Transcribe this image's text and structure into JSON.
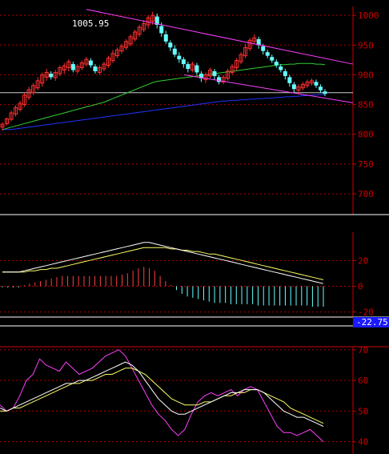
{
  "chart_data": [
    {
      "type": "candlestick",
      "panel": "price",
      "ylim": [
        665,
        1015
      ],
      "y_ticks": [
        700,
        750,
        800,
        850,
        900,
        950,
        1000
      ],
      "peak_label": "1005.95",
      "colors": {
        "up": "#ff3030",
        "down": "#66ffff",
        "ma_short": "#cccccc",
        "ma_mid": "#33cc33",
        "ma_long": "#2233ff",
        "trend": "#ff40ff",
        "axis": "#cc0000"
      },
      "candles": [
        [
          812,
          817,
          806,
          820
        ],
        [
          818,
          826,
          815,
          828
        ],
        [
          825,
          836,
          822,
          840
        ],
        [
          834,
          845,
          830,
          849
        ],
        [
          842,
          852,
          838,
          856
        ],
        [
          850,
          866,
          846,
          870
        ],
        [
          862,
          875,
          858,
          880
        ],
        [
          870,
          882,
          866,
          886
        ],
        [
          878,
          890,
          874,
          896
        ],
        [
          886,
          900,
          880,
          904
        ],
        [
          896,
          904,
          890,
          910
        ],
        [
          902,
          896,
          892,
          906
        ],
        [
          895,
          904,
          890,
          908
        ],
        [
          902,
          912,
          898,
          916
        ],
        [
          908,
          915,
          902,
          920
        ],
        [
          912,
          922,
          906,
          926
        ],
        [
          918,
          908,
          904,
          922
        ],
        [
          906,
          914,
          902,
          918
        ],
        [
          912,
          920,
          908,
          924
        ],
        [
          918,
          926,
          914,
          930
        ],
        [
          924,
          916,
          912,
          928
        ],
        [
          914,
          906,
          902,
          918
        ],
        [
          904,
          912,
          900,
          916
        ],
        [
          910,
          918,
          906,
          922
        ],
        [
          916,
          928,
          912,
          932
        ],
        [
          924,
          936,
          920,
          942
        ],
        [
          932,
          942,
          928,
          946
        ],
        [
          940,
          948,
          936,
          952
        ],
        [
          946,
          956,
          942,
          960
        ],
        [
          952,
          964,
          948,
          968
        ],
        [
          960,
          972,
          956,
          976
        ],
        [
          968,
          980,
          964,
          984
        ],
        [
          976,
          986,
          972,
          992
        ],
        [
          984,
          996,
          978,
          1000
        ],
        [
          990,
          1000,
          984,
          1006
        ],
        [
          998,
          984,
          978,
          1003
        ],
        [
          982,
          970,
          964,
          988
        ],
        [
          968,
          956,
          952,
          974
        ],
        [
          954,
          946,
          940,
          958
        ],
        [
          944,
          934,
          930,
          950
        ],
        [
          932,
          926,
          920,
          938
        ],
        [
          926,
          918,
          912,
          930
        ],
        [
          918,
          910,
          904,
          922
        ],
        [
          908,
          918,
          904,
          922
        ],
        [
          916,
          904,
          900,
          920
        ],
        [
          902,
          894,
          888,
          906
        ],
        [
          892,
          900,
          886,
          904
        ],
        [
          898,
          908,
          894,
          912
        ],
        [
          906,
          898,
          892,
          910
        ],
        [
          896,
          888,
          884,
          900
        ],
        [
          888,
          896,
          884,
          900
        ],
        [
          894,
          906,
          890,
          910
        ],
        [
          904,
          914,
          900,
          918
        ],
        [
          912,
          924,
          908,
          928
        ],
        [
          922,
          934,
          918,
          938
        ],
        [
          932,
          946,
          928,
          952
        ],
        [
          944,
          958,
          940,
          962
        ],
        [
          956,
          962,
          952,
          968
        ],
        [
          960,
          950,
          944,
          964
        ],
        [
          948,
          940,
          934,
          952
        ],
        [
          938,
          932,
          928,
          942
        ],
        [
          930,
          924,
          920,
          934
        ],
        [
          922,
          916,
          912,
          926
        ],
        [
          914,
          908,
          904,
          918
        ],
        [
          906,
          898,
          892,
          910
        ],
        [
          896,
          886,
          880,
          900
        ],
        [
          884,
          876,
          870,
          888
        ],
        [
          874,
          880,
          868,
          884
        ],
        [
          878,
          884,
          874,
          888
        ],
        [
          882,
          888,
          878,
          892
        ],
        [
          886,
          890,
          882,
          894
        ],
        [
          888,
          882,
          878,
          892
        ],
        [
          880,
          874,
          870,
          884
        ],
        [
          872,
          868,
          864,
          876
        ]
      ],
      "ma_short": [
        870,
        870,
        870,
        870,
        870,
        870,
        870,
        870,
        870,
        870,
        870,
        870,
        870,
        870,
        870,
        870,
        870,
        870,
        870,
        870,
        870,
        870,
        870,
        870,
        870,
        870,
        870,
        870,
        870,
        870,
        870,
        870,
        870,
        870,
        870,
        870,
        870,
        870,
        870,
        870,
        870,
        870,
        870,
        870,
        870,
        870,
        870,
        870,
        870,
        870,
        870,
        870,
        870,
        870,
        870,
        870,
        870,
        870,
        870,
        870,
        870,
        870,
        870,
        870,
        870,
        870,
        870,
        870,
        870,
        870,
        870,
        870,
        870,
        870
      ],
      "ma_mid": [
        808,
        810,
        812,
        814,
        816,
        818,
        820,
        822,
        824,
        826,
        828,
        830,
        832,
        834,
        836,
        838,
        840,
        842,
        844,
        846,
        848,
        850,
        852,
        854,
        857,
        860,
        863,
        866,
        869,
        872,
        875,
        878,
        881,
        884,
        887,
        889,
        890,
        891,
        892,
        893,
        894,
        895,
        896,
        897,
        898,
        899,
        900,
        901,
        902,
        903,
        904,
        905,
        906,
        907,
        908,
        909,
        910,
        911,
        912,
        913,
        914,
        915,
        916,
        917,
        917,
        918,
        918,
        919,
        919,
        919,
        919,
        918,
        918,
        917
      ],
      "ma_long": [
        808,
        808,
        808,
        809,
        810,
        811,
        812,
        813,
        814,
        815,
        816,
        817,
        818,
        819,
        820,
        821,
        822,
        823,
        824,
        825,
        826,
        827,
        828,
        829,
        830,
        831,
        832,
        833,
        834,
        835,
        836,
        837,
        838,
        839,
        840,
        841,
        842,
        843,
        844,
        845,
        846,
        847,
        848,
        849,
        850,
        851,
        852,
        853,
        854,
        855,
        856,
        856,
        857,
        857,
        858,
        858,
        859,
        859,
        860,
        860,
        861,
        861,
        862,
        862,
        863,
        863,
        864,
        864,
        865,
        865,
        866,
        866,
        867,
        867
      ]
    },
    {
      "type": "macd",
      "panel": "indicator-1",
      "ylim": [
        -24,
        42
      ],
      "y_ticks": [
        -20,
        0,
        20
      ],
      "value_label": "-22.75",
      "colors": {
        "dif": "#ffffff",
        "dea": "#ffff66",
        "pos": "#ff4040",
        "neg": "#66ffff"
      },
      "dif": [
        11,
        11,
        11,
        11,
        12,
        13,
        14,
        15,
        16,
        17,
        18,
        19,
        20,
        21,
        22,
        23,
        24,
        25,
        26,
        27,
        28,
        29,
        30,
        31,
        32,
        33,
        34,
        34,
        33,
        32,
        31,
        30,
        29,
        28,
        27,
        26,
        25,
        24,
        23,
        22,
        21,
        20,
        19,
        18,
        17,
        16,
        15,
        14,
        13,
        12,
        11,
        10,
        9,
        8,
        7,
        6,
        5,
        4,
        3,
        2
      ],
      "dea": [
        11,
        11,
        11,
        11,
        11,
        12,
        12,
        13,
        13,
        14,
        14,
        15,
        16,
        17,
        18,
        19,
        20,
        21,
        22,
        23,
        24,
        25,
        26,
        27,
        28,
        29,
        30,
        30,
        30,
        30,
        30,
        29,
        29,
        28,
        28,
        27,
        27,
        26,
        25,
        25,
        24,
        23,
        22,
        21,
        20,
        19,
        18,
        17,
        16,
        15,
        14,
        13,
        12,
        11,
        10,
        9,
        8,
        7,
        6,
        5
      ],
      "hist": [
        -1,
        -1,
        -1,
        -1,
        1,
        2,
        3,
        4,
        5,
        6,
        7,
        8,
        8,
        8,
        8,
        8,
        8,
        8,
        8,
        8,
        8,
        8,
        9,
        10,
        12,
        14,
        15,
        14,
        12,
        8,
        4,
        1,
        -3,
        -6,
        -8,
        -9,
        -10,
        -11,
        -12,
        -13,
        -13,
        -13,
        -14,
        -14,
        -14,
        -14,
        -14,
        -15,
        -15,
        -15,
        -15,
        -15,
        -15,
        -15,
        -15,
        -15,
        -15,
        -16,
        -16,
        -16
      ]
    },
    {
      "type": "kdj",
      "panel": "indicator-2",
      "ylim": [
        36,
        71
      ],
      "y_ticks": [
        40,
        50,
        60,
        70
      ],
      "colors": {
        "k": "#ffffff",
        "d": "#ffff66",
        "j": "#ff40ff"
      },
      "k": [
        51,
        50,
        51,
        52,
        53,
        54,
        55,
        56,
        57,
        58,
        59,
        59,
        60,
        60,
        61,
        62,
        63,
        64,
        65,
        66,
        65,
        63,
        60,
        57,
        54,
        52,
        50,
        49,
        49,
        50,
        51,
        52,
        53,
        54,
        55,
        56,
        56,
        57,
        57,
        57,
        56,
        54,
        52,
        50,
        49,
        48,
        48,
        47,
        46,
        45
      ],
      "d": [
        50,
        50,
        51,
        51,
        52,
        53,
        54,
        55,
        56,
        57,
        58,
        59,
        59,
        60,
        60,
        61,
        62,
        62,
        63,
        64,
        64,
        63,
        62,
        60,
        58,
        56,
        54,
        53,
        52,
        52,
        52,
        53,
        53,
        54,
        55,
        55,
        56,
        56,
        57,
        57,
        56,
        55,
        54,
        53,
        51,
        50,
        49,
        48,
        47,
        46
      ],
      "j": [
        52,
        50,
        51,
        55,
        60,
        62,
        67,
        65,
        64,
        63,
        66,
        64,
        62,
        63,
        64,
        66,
        68,
        69,
        70,
        68,
        64,
        60,
        56,
        52,
        49,
        47,
        44,
        42,
        44,
        49,
        53,
        55,
        56,
        55,
        56,
        57,
        55,
        57,
        58,
        57,
        53,
        49,
        45,
        43,
        43,
        42,
        43,
        44,
        42,
        40
      ]
    }
  ]
}
